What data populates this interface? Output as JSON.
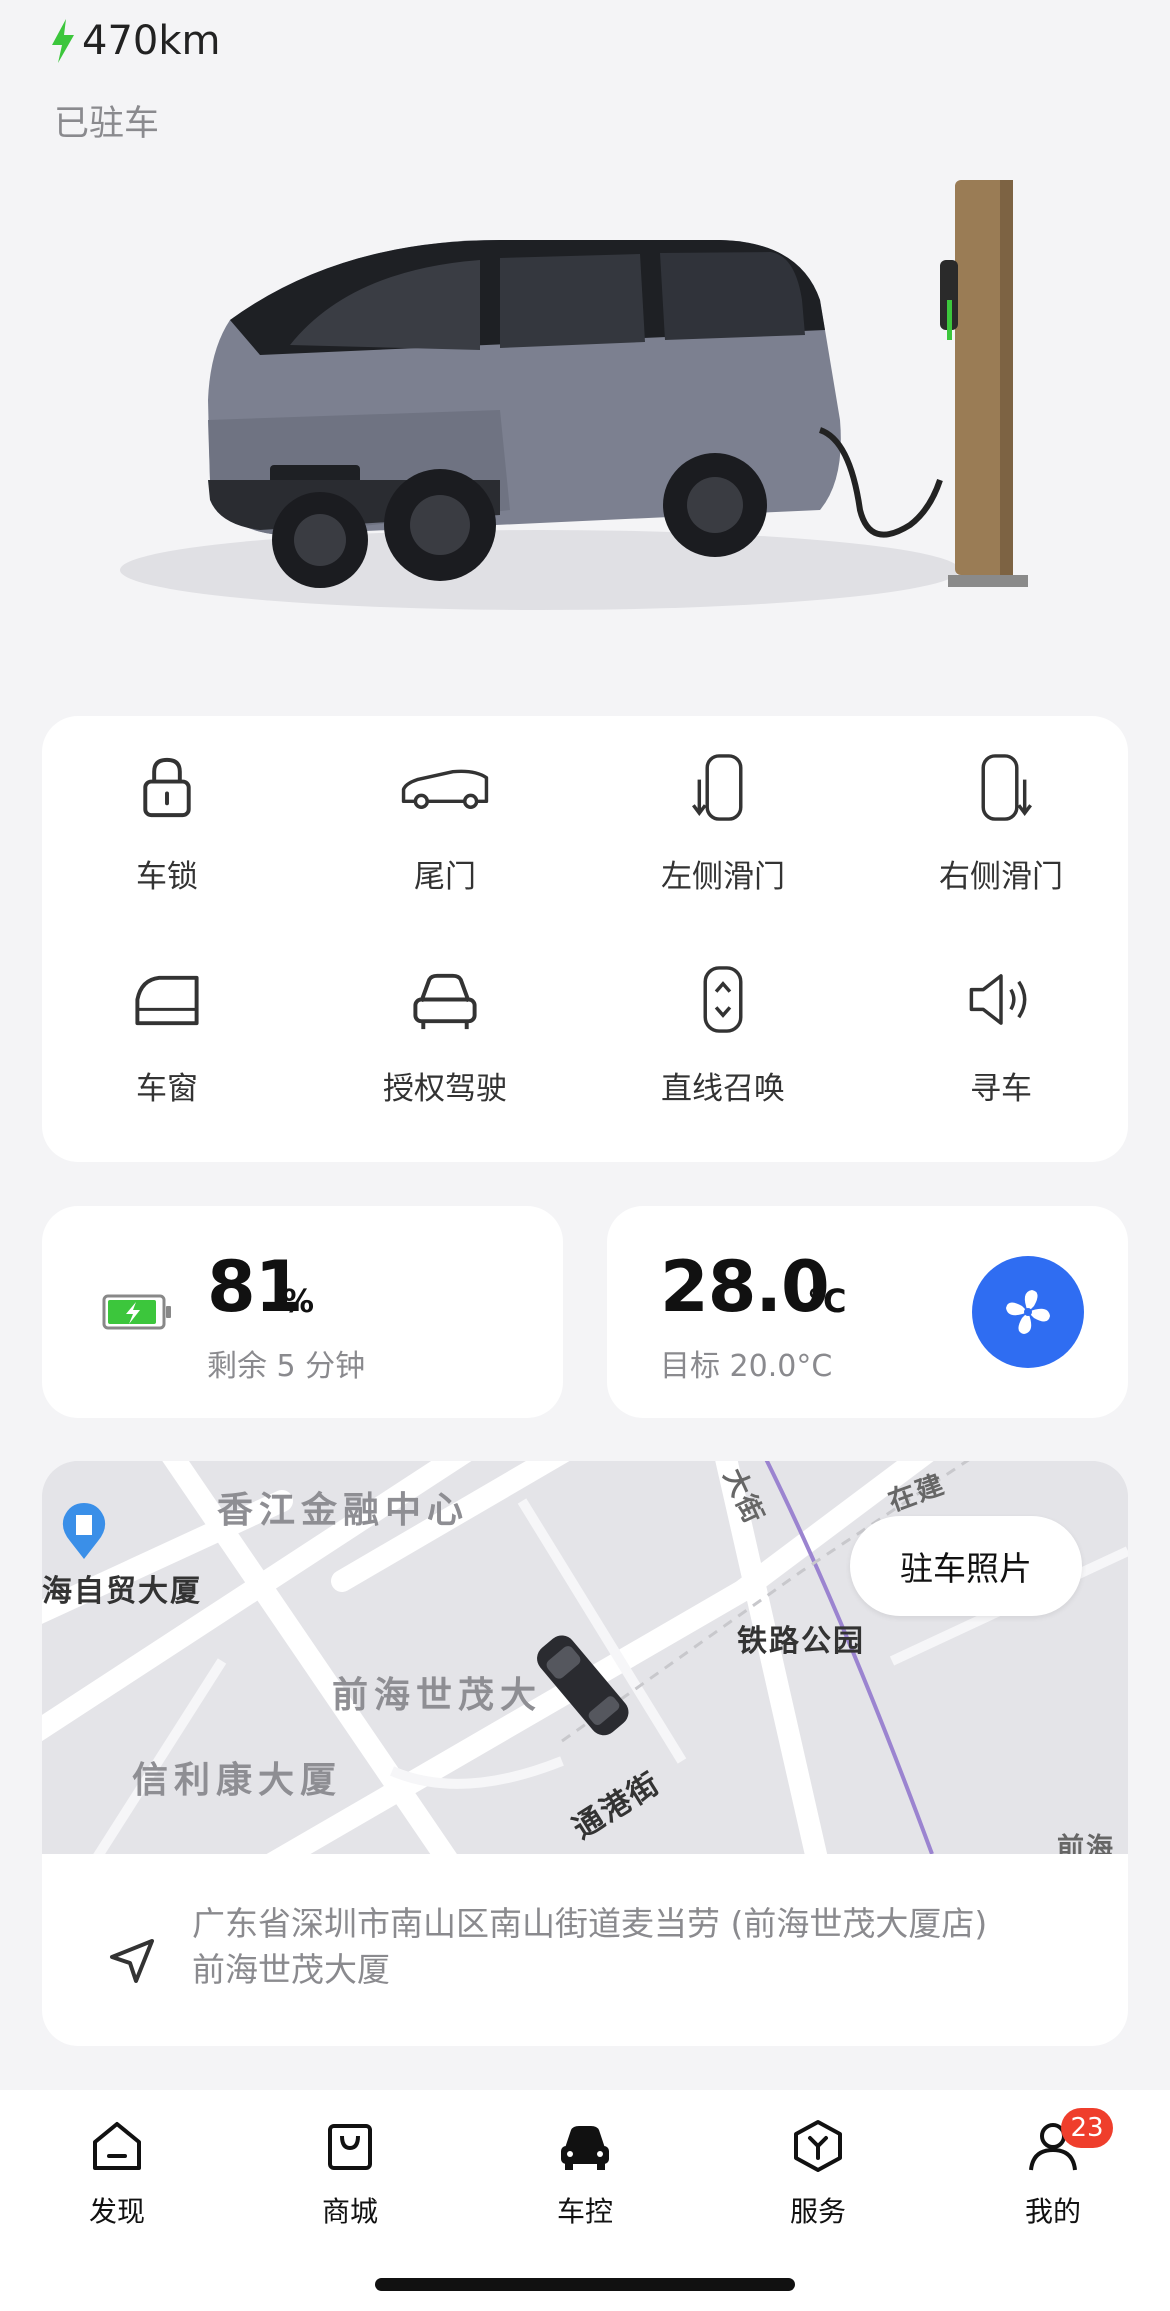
{
  "header": {
    "range": "470km",
    "status": "已驻车"
  },
  "controls": [
    {
      "label": "车锁",
      "icon": "lock-icon"
    },
    {
      "label": "尾门",
      "icon": "tailgate-icon"
    },
    {
      "label": "左侧滑门",
      "icon": "left-sliding-door-icon"
    },
    {
      "label": "右侧滑门",
      "icon": "right-sliding-door-icon"
    },
    {
      "label": "车窗",
      "icon": "window-icon"
    },
    {
      "label": "授权驾驶",
      "icon": "authorized-driving-icon"
    },
    {
      "label": "直线召唤",
      "icon": "straight-summon-icon"
    },
    {
      "label": "寻车",
      "icon": "find-car-icon"
    }
  ],
  "battery": {
    "percent": "81",
    "unit": "%",
    "remaining": "剩余 5 分钟",
    "icon": "charging-battery-icon"
  },
  "climate": {
    "temperature": "28.0",
    "unit": "°C",
    "target": "目标 20.0°C",
    "icon": "fan-icon"
  },
  "map": {
    "labels": {
      "finance_center": "香江金融中心",
      "trade_building": "海自贸大厦",
      "shimao": "前海世茂大",
      "xinlikang": "信利康大厦",
      "railway_park": "铁路公园",
      "tonggang": "通港街",
      "street_top": "大街",
      "zaijian": "在建",
      "qianhai": "前海"
    },
    "parking_photo_button": "驻车照片",
    "address_line1": "广东省深圳市南山区南山街道麦当劳 (前海世茂大厦店)",
    "address_line2": "前海世茂大厦"
  },
  "tabbar": [
    {
      "label": "发现",
      "icon": "home-icon"
    },
    {
      "label": "商城",
      "icon": "shopping-bag-icon"
    },
    {
      "label": "车控",
      "icon": "car-control-icon",
      "active": true
    },
    {
      "label": "服务",
      "icon": "service-icon"
    },
    {
      "label": "我的",
      "icon": "profile-icon",
      "badge": "23"
    }
  ],
  "colors": {
    "accent_blue": "#2f6df2",
    "charge_green": "#3cc63c",
    "badge_red": "#ef3e2c"
  }
}
